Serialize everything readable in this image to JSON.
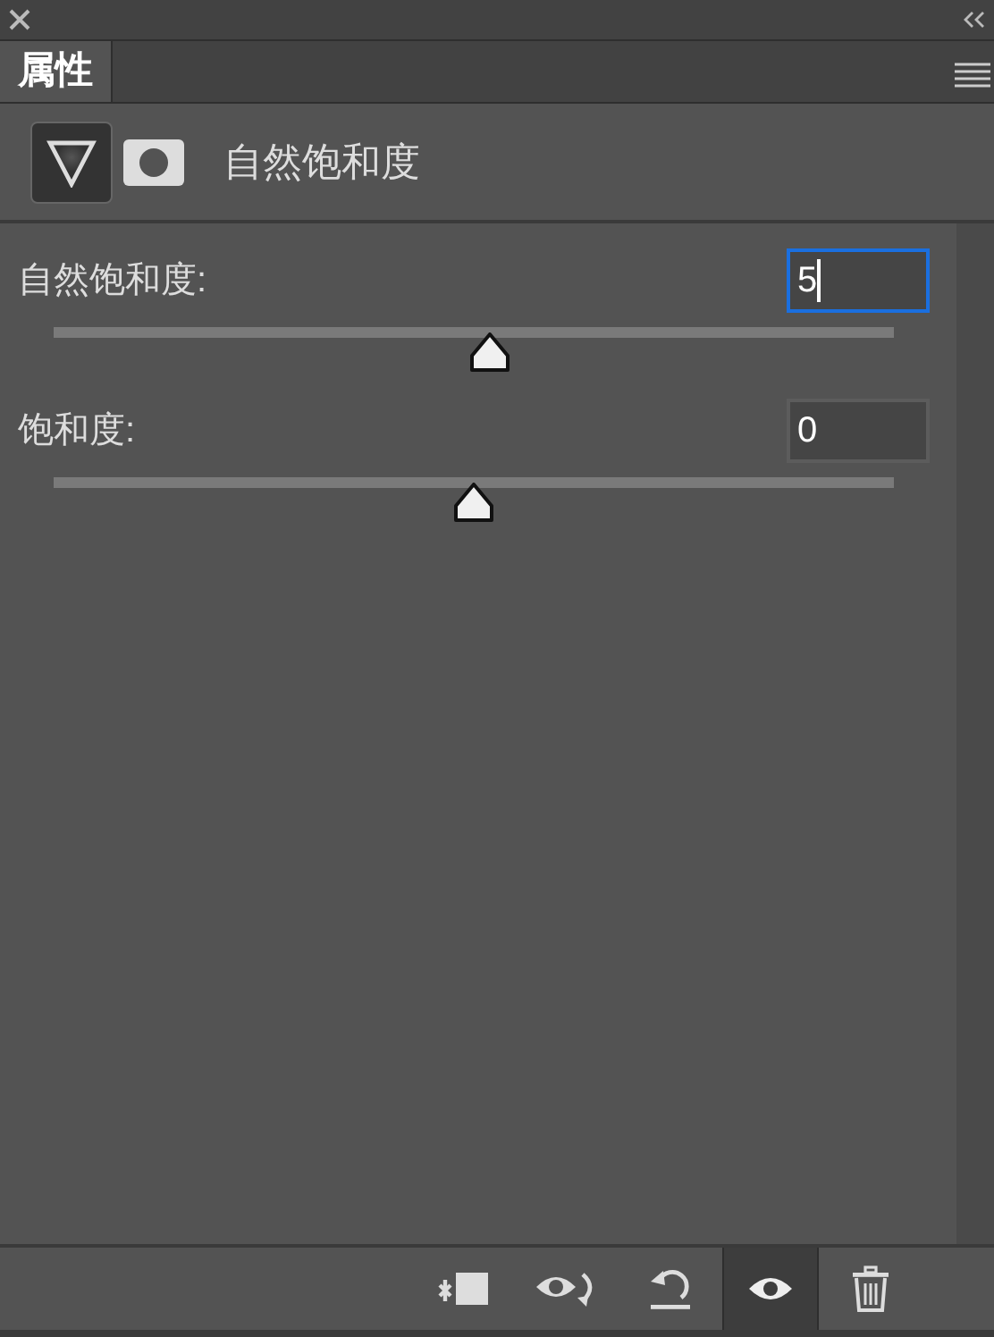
{
  "panel_tabs": [
    {
      "label": "属性",
      "selected": true
    }
  ],
  "header": {
    "title": "自然饱和度"
  },
  "sliders": [
    {
      "label": "自然饱和度:",
      "value": "5",
      "focused": true,
      "level": 0.52
    },
    {
      "label": "饱和度:",
      "value": "0",
      "focused": false,
      "level": 0.5
    }
  ],
  "footer_buttons": [
    {
      "kind": "clip",
      "selected": false
    },
    {
      "kind": "view-previous",
      "selected": false
    },
    {
      "kind": "reset",
      "selected": false
    },
    {
      "kind": "visibility",
      "selected": true
    },
    {
      "kind": "delete",
      "selected": false
    }
  ]
}
